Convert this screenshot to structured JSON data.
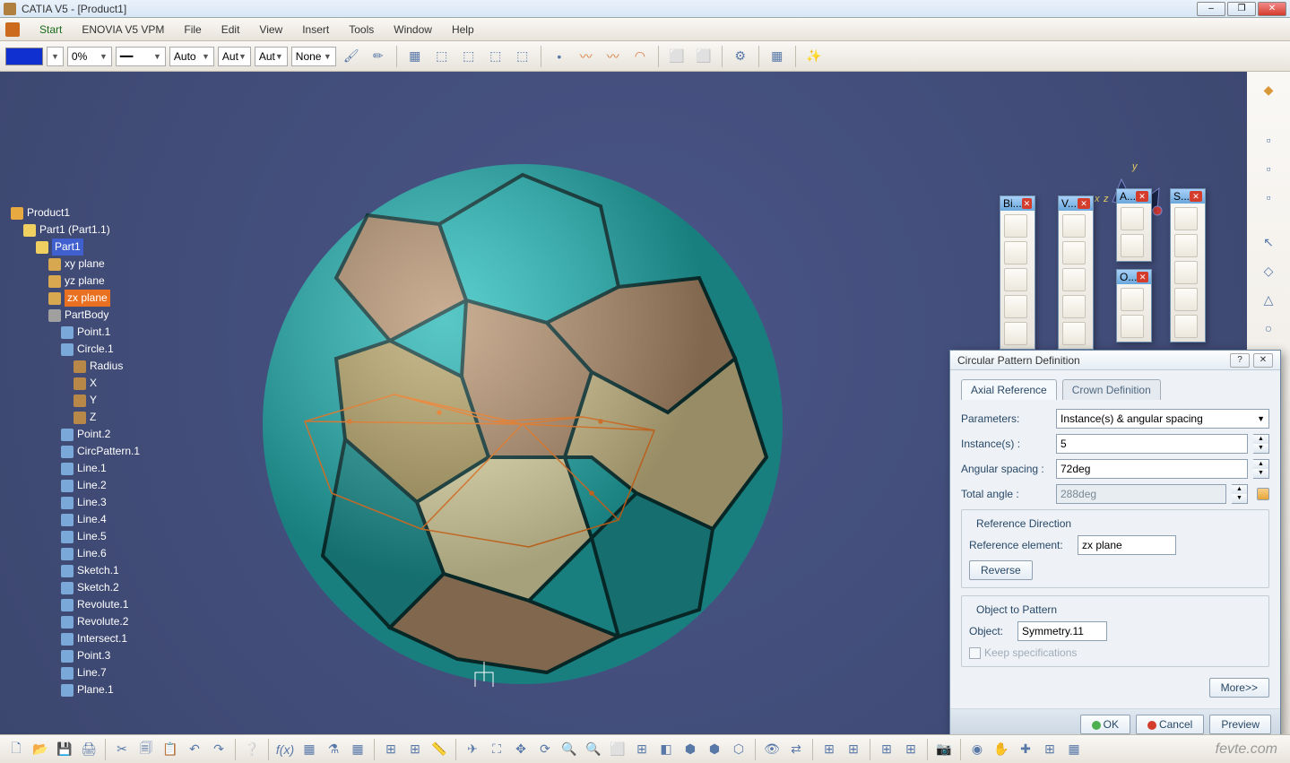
{
  "title": "CATIA V5 - [Product1]",
  "menu": {
    "start": "Start",
    "enovia": "ENOVIA V5 VPM",
    "file": "File",
    "edit": "Edit",
    "view": "View",
    "insert": "Insert",
    "tools": "Tools",
    "window": "Window",
    "help": "Help"
  },
  "toolbar": {
    "opacity": "0%",
    "auto1": "Auto",
    "auto2": "Aut",
    "auto3": "Aut",
    "none": "None"
  },
  "tree": {
    "root": "Product1",
    "part1": "Part1 (Part1.1)",
    "part1b": "Part1",
    "xy": "xy plane",
    "yz": "yz plane",
    "zx": "zx plane",
    "body": "PartBody",
    "pt1": "Point.1",
    "circ1": "Circle.1",
    "rad": "Radius",
    "x": "X",
    "y": "Y",
    "z": "Z",
    "pt2": "Point.2",
    "cpat": "CircPattern.1",
    "l1": "Line.1",
    "l2": "Line.2",
    "l3": "Line.3",
    "l4": "Line.4",
    "l5": "Line.5",
    "l6": "Line.6",
    "sk1": "Sketch.1",
    "sk2": "Sketch.2",
    "rv1": "Revolute.1",
    "rv2": "Revolute.2",
    "int1": "Intersect.1",
    "pt3": "Point.3",
    "l7": "Line.7",
    "pl1": "Plane.1"
  },
  "compass": {
    "x": "x",
    "y": "y",
    "z": "z"
  },
  "palettes": {
    "bi": "Bi...",
    "v": "V...",
    "a": "A...",
    "o": "O...",
    "s": "S..."
  },
  "dialog": {
    "title": "Circular Pattern Definition",
    "tab_axial": "Axial Reference",
    "tab_crown": "Crown Definition",
    "params_lbl": "Parameters:",
    "params_val": "Instance(s) & angular spacing",
    "inst_lbl": "Instance(s) :",
    "inst_val": "5",
    "ang_lbl": "Angular spacing :",
    "ang_val": "72deg",
    "tot_lbl": "Total angle :",
    "tot_val": "288deg",
    "refdir": "Reference Direction",
    "refel_lbl": "Reference element:",
    "refel_val": "zx plane",
    "reverse": "Reverse",
    "objpat": "Object to Pattern",
    "obj_lbl": "Object:",
    "obj_val": "Symmetry.11",
    "keep": "Keep specifications",
    "more": "More>>",
    "ok": "OK",
    "cancel": "Cancel",
    "preview": "Preview"
  },
  "watermark": "fevte.com"
}
